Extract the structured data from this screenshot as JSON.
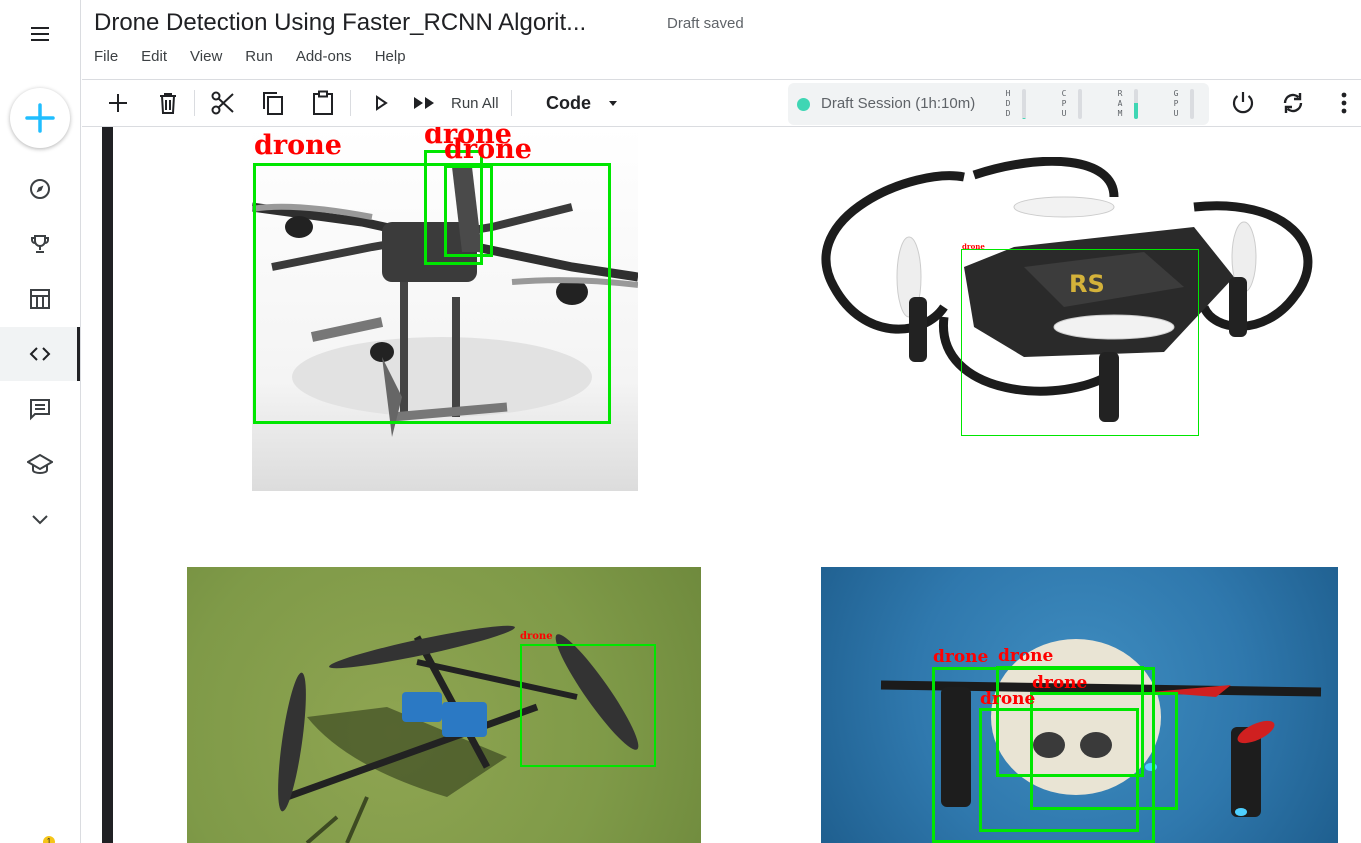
{
  "header": {
    "title": "Drone Detection Using Faster_RCNN Algorit...",
    "status": "Draft saved"
  },
  "menu": [
    "File",
    "Edit",
    "View",
    "Run",
    "Add-ons",
    "Help"
  ],
  "toolbar": {
    "run_all_label": "Run All",
    "cell_type": "Code"
  },
  "session": {
    "label": "Draft Session (1h:10m)",
    "status_color": "#3fd6b4",
    "meters": [
      {
        "name": "HDD",
        "letters": [
          "H",
          "D",
          "D"
        ],
        "level": 0.05
      },
      {
        "name": "CPU",
        "letters": [
          "C",
          "P",
          "U"
        ],
        "level": 0.0
      },
      {
        "name": "RAM",
        "letters": [
          "R",
          "A",
          "M"
        ],
        "level": 0.55
      },
      {
        "name": "GPU",
        "letters": [
          "G",
          "P",
          "U"
        ],
        "level": 0.0
      }
    ]
  },
  "nav": {
    "items": [
      "menu-icon",
      "create-icon",
      "compass-icon",
      "trophy-icon",
      "table-icon",
      "code-icon",
      "comment-icon",
      "school-icon",
      "chevron-down-icon"
    ],
    "active": "code-icon",
    "notification_count": "1"
  },
  "output": {
    "detection_label": "drone",
    "images": [
      {
        "name": "drone-image-1",
        "detections": 3
      },
      {
        "name": "drone-image-2",
        "detections": 1
      },
      {
        "name": "drone-image-3",
        "detections": 1
      },
      {
        "name": "drone-image-4",
        "detections": 4
      }
    ]
  },
  "colors": {
    "accent": "#20beff",
    "box": "#00e600",
    "label": "#ff0000"
  }
}
